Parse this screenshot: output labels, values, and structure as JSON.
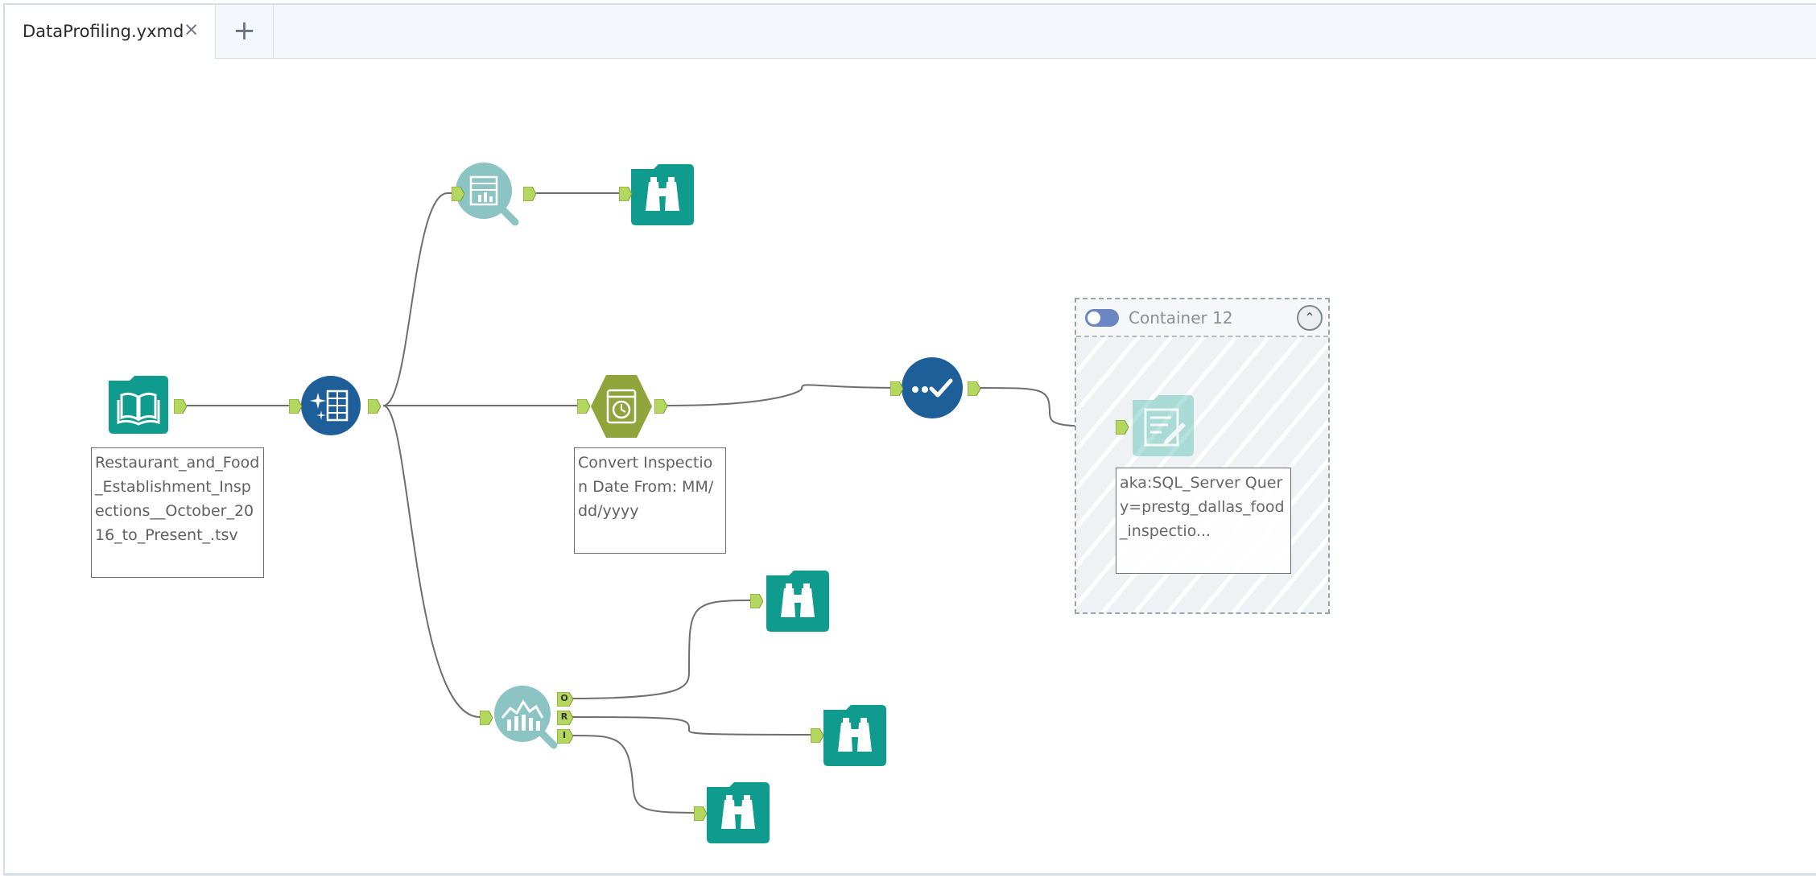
{
  "tabs": [
    {
      "label": "DataProfiling.yxmd",
      "close": "×"
    }
  ],
  "new_tab": "+",
  "colors": {
    "teal": "#0f9b8e",
    "navy": "#1f5f99",
    "olive": "#8fa43a",
    "anchor": "#b4d75f",
    "wire": "#6e6e6e"
  },
  "tools": {
    "input": {
      "icon": "book-icon",
      "annotation": "Restaurant_and_Food_Establishment_Inspections__October_2016_to_Present_.tsv"
    },
    "auto_field": {
      "icon": "auto-field-icon"
    },
    "field_summary": {
      "icon": "field-summary-icon"
    },
    "browse_top": {
      "icon": "binoculars-icon"
    },
    "datetime": {
      "icon": "clock-icon",
      "annotation": "Convert Inspection Date From: MM/dd/yyyy"
    },
    "data_cleanse": {
      "icon": "checkmark-icon"
    },
    "output": {
      "icon": "output-note-icon",
      "annotation": "aka:SQL_Server Query=prestg_dallas_food_inspectio..."
    },
    "histogram": {
      "icon": "histogram-icon",
      "anchors": [
        "O",
        "R",
        "I"
      ]
    },
    "browse_o": {
      "icon": "binoculars-icon"
    },
    "browse_r": {
      "icon": "binoculars-icon"
    },
    "browse_i": {
      "icon": "binoculars-icon"
    }
  },
  "container": {
    "title": "Container 12",
    "collapse": "⌃"
  }
}
